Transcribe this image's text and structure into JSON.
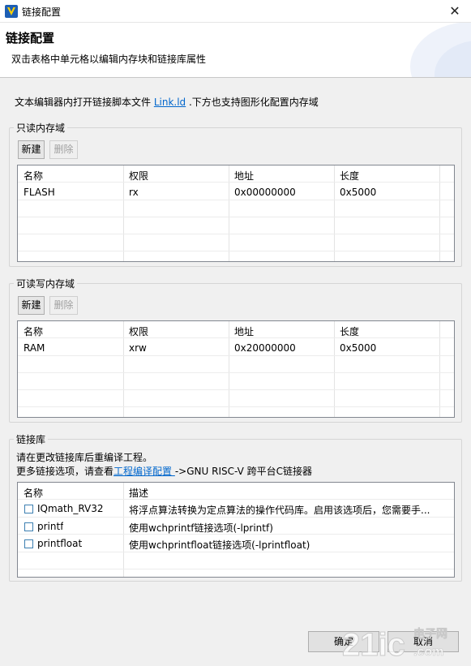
{
  "window": {
    "title": "链接配置",
    "close_glyph": "✕"
  },
  "header": {
    "title": "链接配置",
    "subtitle": "双击表格中单元格以编辑内存块和链接库属性"
  },
  "intro": {
    "prefix": "文本编辑器内打开链接脚本文件 ",
    "link": "Link.ld",
    "suffix": " .下方也支持图形化配置内存域"
  },
  "readonly": {
    "legend": "只读内存域",
    "new_label": "新建",
    "delete_label": "删除",
    "columns": [
      "名称",
      "权限",
      "地址",
      "长度"
    ],
    "rows": [
      [
        "FLASH",
        "rx",
        "0x00000000",
        "0x5000"
      ]
    ]
  },
  "readwrite": {
    "legend": "可读写内存域",
    "new_label": "新建",
    "delete_label": "删除",
    "columns": [
      "名称",
      "权限",
      "地址",
      "长度"
    ],
    "rows": [
      [
        "RAM",
        "xrw",
        "0x20000000",
        "0x5000"
      ]
    ]
  },
  "libs": {
    "legend": "链接库",
    "note1": "请在更改链接库后重编译工程。",
    "note2_prefix": "更多链接选项，请查看",
    "note2_link": "工程编译配置 ",
    "note2_suffix": "->GNU RISC-V 跨平台C链接器",
    "columns": [
      "名称",
      "描述"
    ],
    "rows": [
      {
        "name": "IQmath_RV32",
        "desc": "将浮点算法转换为定点算法的操作代码库。启用该选项后，您需要手...",
        "checked": false
      },
      {
        "name": "printf",
        "desc": "使用wchprintf链接选项(-lprintf)",
        "checked": false
      },
      {
        "name": "printfloat",
        "desc": "使用wchprintfloat链接选项(-lprintfloat)",
        "checked": false
      }
    ]
  },
  "footer": {
    "ok_label": "确定",
    "cancel_label": "取消"
  },
  "watermark": {
    "text": "21ic",
    "sub": "电子网",
    "url": ".com"
  },
  "colors": {
    "link": "#0066cc",
    "accent": "#3c7fb1"
  }
}
